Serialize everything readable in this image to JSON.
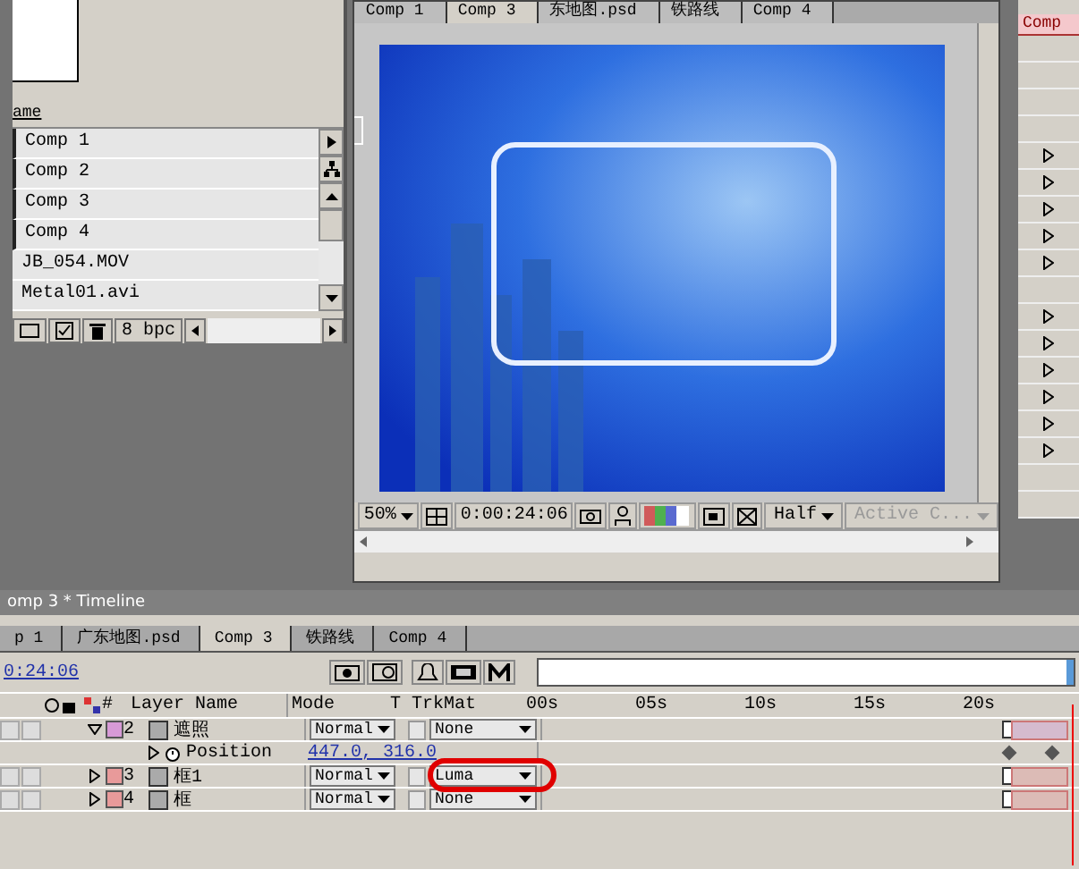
{
  "project_panel": {
    "column_header": "ame",
    "items": [
      {
        "name": "Comp 1",
        "kind": "comp"
      },
      {
        "name": "Comp 2",
        "kind": "comp"
      },
      {
        "name": "Comp 3",
        "kind": "comp"
      },
      {
        "name": "Comp 4",
        "kind": "comp"
      },
      {
        "name": "JB_054.MOV",
        "kind": "footage"
      },
      {
        "name": "Metal01.avi",
        "kind": "footage"
      }
    ],
    "bit_depth": "8 bpc"
  },
  "viewer": {
    "tabs": [
      {
        "label": "Comp 1",
        "selected": false
      },
      {
        "label": "Comp 3",
        "selected": true
      },
      {
        "label": "东地图.psd",
        "selected": false
      },
      {
        "label": "铁路线",
        "selected": false
      },
      {
        "label": "Comp 4",
        "selected": false
      }
    ],
    "zoom": "50%",
    "timecode": "0:00:24:06",
    "resolution": "Half",
    "camera": "Active C..."
  },
  "side_panel": {
    "header": "Comp"
  },
  "timeline": {
    "title": "omp 3 * Timeline",
    "tabs": [
      {
        "label": "p 1",
        "selected": false
      },
      {
        "label": "广东地图.psd",
        "selected": false
      },
      {
        "label": "Comp 3",
        "selected": true
      },
      {
        "label": "铁路线",
        "selected": false
      },
      {
        "label": "Comp 4",
        "selected": false
      }
    ],
    "current_time": "0:24:06",
    "columns": {
      "number": "#",
      "layer_name": "Layer Name",
      "mode": "Mode",
      "t": "T",
      "trkmat": "TrkMat"
    },
    "layers": [
      {
        "number": "2",
        "video_visible": false,
        "audio_on": false,
        "name": "遮照",
        "color": "#d79ad6",
        "expanded": true,
        "mode": "Normal",
        "preserve_transparency": false,
        "trkmat": "None",
        "properties": [
          {
            "name": "Position",
            "value": "447.0, 316.0"
          }
        ]
      },
      {
        "number": "3",
        "video_visible": false,
        "audio_on": false,
        "name": "框1",
        "color": "#e89a9a",
        "expanded": false,
        "mode": "Normal",
        "preserve_transparency": false,
        "trkmat": "Luma"
      },
      {
        "number": "4",
        "video_visible": false,
        "audio_on": false,
        "name": "框",
        "color": "#e89a9a",
        "expanded": false,
        "mode": "Normal",
        "preserve_transparency": false,
        "trkmat": "None"
      }
    ],
    "ruler": [
      "00s",
      "05s",
      "10s",
      "15s",
      "20s"
    ]
  }
}
